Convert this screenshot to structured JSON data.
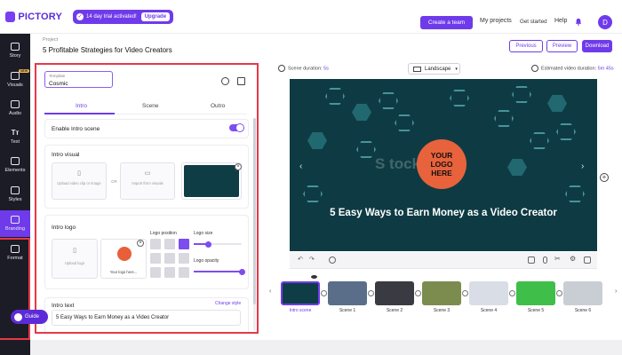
{
  "app": {
    "name": "PICTORY"
  },
  "trial": {
    "text": "14 day trial activated!",
    "upgrade_label": "Upgrade"
  },
  "nav": {
    "create_team": "Create a team",
    "my_projects": "My projects",
    "get_started": "Get started",
    "help": "Help",
    "avatar_initial": "D"
  },
  "project": {
    "label": "Project",
    "title": "5 Profitable Strategies for Video Creators",
    "previous": "Previous",
    "preview": "Preview",
    "download": "Download"
  },
  "sidebar": {
    "items": [
      {
        "label": "Story",
        "icon": "story-icon"
      },
      {
        "label": "Visuals",
        "icon": "visuals-icon",
        "badge": "NEW"
      },
      {
        "label": "Audio",
        "icon": "audio-icon"
      },
      {
        "label": "Text",
        "icon": "text-icon"
      },
      {
        "label": "Elements",
        "icon": "elements-icon"
      },
      {
        "label": "Styles",
        "icon": "styles-icon"
      },
      {
        "label": "Branding",
        "icon": "branding-icon",
        "active": true
      },
      {
        "label": "Format",
        "icon": "format-icon"
      }
    ],
    "guide": "Guide"
  },
  "panel": {
    "template_label": "Template",
    "template_value": "Cosmic",
    "tabs": [
      "Intro",
      "Scene",
      "Outro"
    ],
    "active_tab": "Intro",
    "enable_intro": "Enable Intro scene",
    "intro_enabled": true,
    "intro_visual": {
      "title": "Intro visual",
      "upload_text": "Upload video clip or image",
      "or": "OR",
      "import_text": "Import from visuals"
    },
    "intro_logo": {
      "title": "Intro logo",
      "upload_text": "Upload logo",
      "logo_caption": "Your logo here...",
      "position_label": "Logo position",
      "size_label": "Logo size",
      "opacity_label": "Logo opacity",
      "size_value": 0.3,
      "opacity_value": 1.0,
      "selected_position": "top-right"
    },
    "intro_text": {
      "title": "Intro text",
      "change_style": "Change style",
      "value": "5 Easy Ways to Earn Money as a Video Creator"
    }
  },
  "preview": {
    "scene_duration_label": "Scene duration:",
    "scene_duration_value": "5s",
    "aspect": "Landscape",
    "estimated_label": "Estimated video duration:",
    "estimated_value": "5m 45s",
    "logo_text": "YOUR\nLOGO\nHERE",
    "watermark": "S        tocks",
    "title": "5 Easy Ways to Earn Money as a Video Creator"
  },
  "timeline": {
    "scenes": [
      "Intro scene",
      "Scene 1",
      "Scene 2",
      "Scene 3",
      "Scene 4",
      "Scene 5",
      "Scene 6"
    ],
    "selected": "Intro scene"
  },
  "colors": {
    "accent": "#6f3bea",
    "highlight": "#e53948",
    "sidebar": "#1c1c26",
    "scene_bg": "#0e3b43",
    "logo_orange": "#e8623c"
  }
}
